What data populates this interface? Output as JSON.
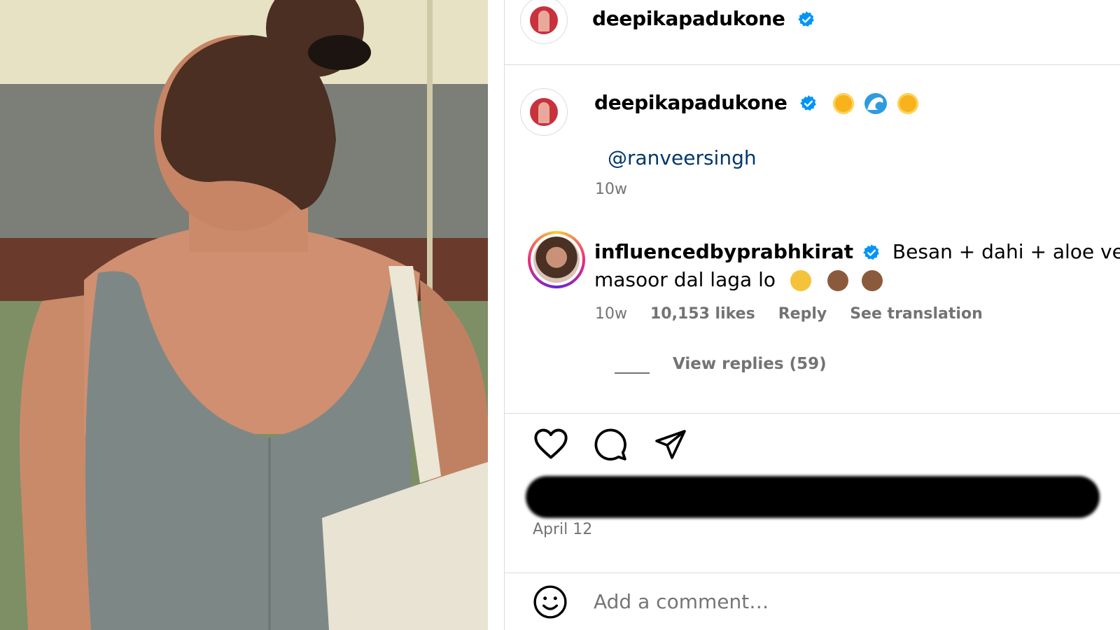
{
  "header": {
    "username": "deepikapadukone",
    "verified": true
  },
  "caption": {
    "username": "deepikapadukone",
    "emojis": [
      "sun",
      "wave",
      "sun"
    ],
    "mention": "@ranveersingh",
    "time": "10w"
  },
  "comment": {
    "username": "influencedbyprabhkirat",
    "text_line1": "Besan + dahi + aloe vera ge",
    "text_line2": "masoor dal laga lo",
    "emojis": [
      "laughing",
      "see-no-evil-monkey",
      "see-no-evil-monkey"
    ],
    "time": "10w",
    "likes": "10,153 likes",
    "reply": "Reply",
    "see_translation": "See translation",
    "view_replies": "View replies (59)"
  },
  "actions": {
    "icons": [
      "heart-icon",
      "comment-icon",
      "share-icon"
    ]
  },
  "post_date": "April 12",
  "add_comment": {
    "placeholder": "Add a comment…",
    "icon": "emoji-icon"
  },
  "colors": {
    "link": "#00376b",
    "muted": "#737373",
    "verified": "#0095f6",
    "divider": "#dbdbdb"
  }
}
